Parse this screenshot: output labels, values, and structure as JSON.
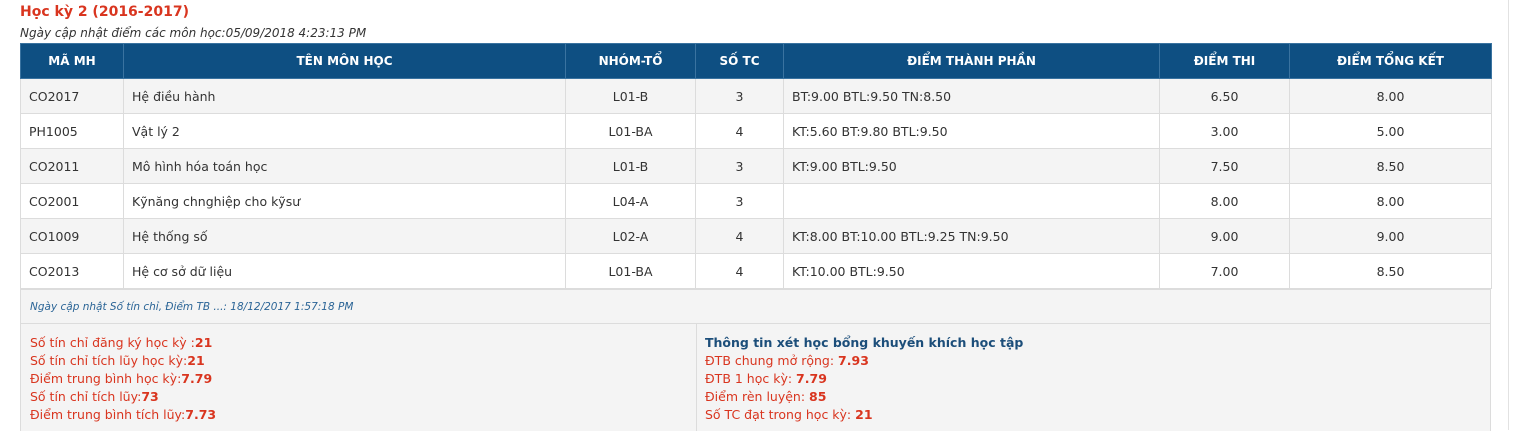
{
  "semester": {
    "title": "Học kỳ 2 (2016-2017)",
    "update_note": "Ngày cập nhật điểm các môn học:05/09/2018 4:23:13 PM"
  },
  "table": {
    "headers": {
      "code": "MÃ MH",
      "name": "TÊN MÔN HỌC",
      "group": "NHÓM-TỔ",
      "credits": "SỐ TC",
      "components": "ĐIỂM THÀNH PHẦN",
      "exam": "ĐIỂM THI",
      "final": "ĐIỂM TỔNG KẾT"
    },
    "rows": [
      {
        "code": "CO2017",
        "name": "Hệ điều hành",
        "group": "L01-B",
        "credits": "3",
        "components": "BT:9.00 BTL:9.50 TN:8.50",
        "exam": "6.50",
        "final": "8.00"
      },
      {
        "code": "PH1005",
        "name": "Vật lý 2",
        "group": "L01-BA",
        "credits": "4",
        "components": "KT:5.60 BT:9.80 BTL:9.50",
        "exam": "3.00",
        "final": "5.00"
      },
      {
        "code": "CO2011",
        "name": "Mô hình hóa toán học",
        "group": "L01-B",
        "credits": "3",
        "components": "KT:9.00 BTL:9.50",
        "exam": "7.50",
        "final": "8.50"
      },
      {
        "code": "CO2001",
        "name": "Kỹnăng chnghiệp cho kỹsư",
        "group": "L04-A",
        "credits": "3",
        "components": "",
        "exam": "8.00",
        "final": "8.00"
      },
      {
        "code": "CO1009",
        "name": "Hệ thống số",
        "group": "L02-A",
        "credits": "4",
        "components": "KT:8.00 BT:10.00 BTL:9.25 TN:9.50",
        "exam": "9.00",
        "final": "9.00"
      },
      {
        "code": "CO2013",
        "name": "Hệ cơ sở dữ liệu",
        "group": "L01-BA",
        "credits": "4",
        "components": "KT:10.00 BTL:9.50",
        "exam": "7.00",
        "final": "8.50"
      }
    ]
  },
  "summary": {
    "update_note": "Ngày cập nhật Số tín chỉ, Điểm TB ...: 18/12/2017 1:57:18 PM",
    "credits": [
      {
        "label": "Số tín chỉ đăng ký học kỳ :",
        "value": "21"
      },
      {
        "label": "Số tín chỉ tích lũy học kỳ:",
        "value": "21"
      },
      {
        "label": "Điểm trung bình học kỳ:",
        "value": "7.79"
      },
      {
        "label": "Số tín chỉ tích lũy:",
        "value": "73"
      },
      {
        "label": "Điểm trung bình tích lũy:",
        "value": "7.73"
      }
    ],
    "scholarship": {
      "title": "Thông tin xét học bổng khuyến khích học tập",
      "items": [
        {
          "label": "ĐTB chung mở rộng: ",
          "value": "7.93"
        },
        {
          "label": "ĐTB 1 học kỳ: ",
          "value": "7.79"
        },
        {
          "label": "Điểm rèn luyện: ",
          "value": "85"
        },
        {
          "label": "Số TC đạt trong học kỳ: ",
          "value": "21"
        }
      ]
    }
  },
  "colors": {
    "header_bg": "#0e4f82",
    "accent_red": "#d9351f",
    "link_blue": "#2a6496",
    "title_blue": "#1c4e7a"
  }
}
